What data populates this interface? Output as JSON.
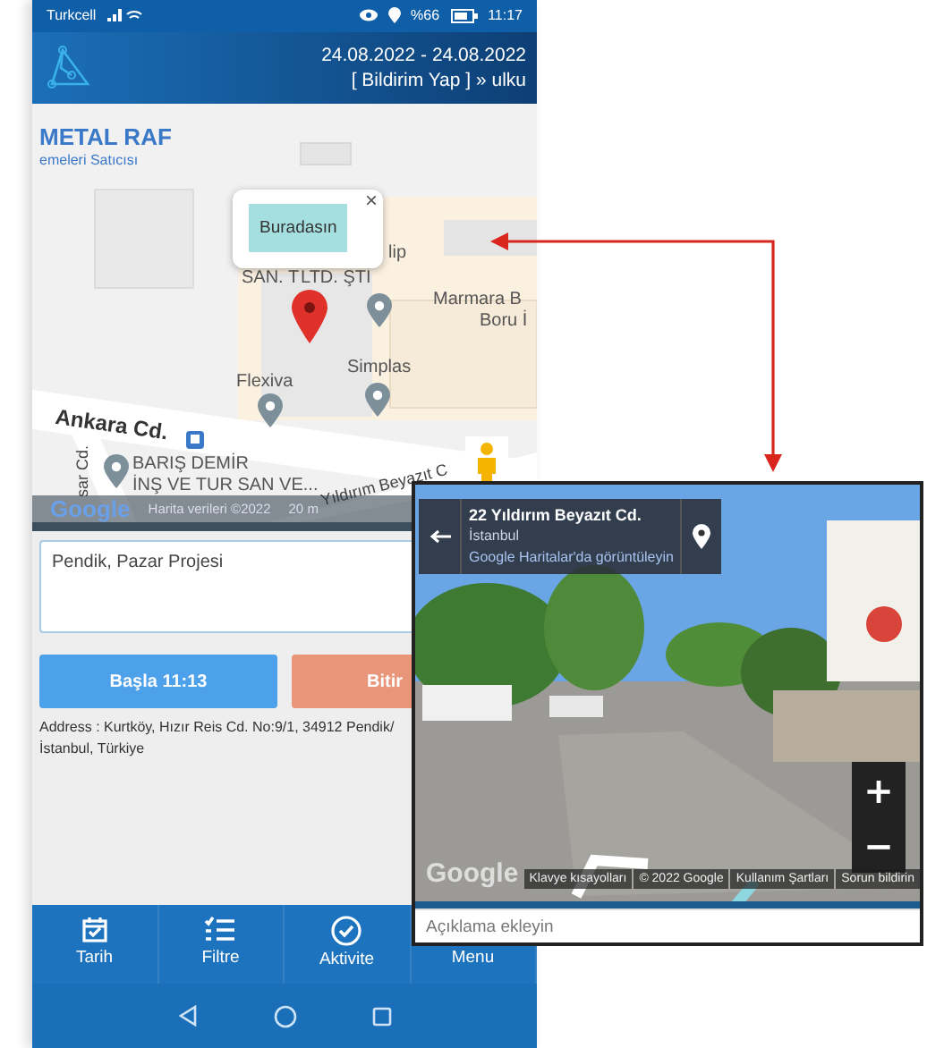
{
  "status_bar": {
    "carrier": "Turkcell",
    "battery": "%66",
    "time": "11:17"
  },
  "header": {
    "date_range": "24.08.2022 - 24.08.2022",
    "breadcrumb": "[ Bildirim Yap ] » ulku"
  },
  "map": {
    "labels": [
      {
        "text": "METAL RAF",
        "kind": "place"
      },
      {
        "text": "emeleri Satıcısı",
        "kind": "place_sub"
      },
      {
        "text": "lip",
        "kind": "poi"
      },
      {
        "text": "SAN. T",
        "kind": "poi"
      },
      {
        "text": "LTD. ŞTİ",
        "kind": "poi"
      },
      {
        "text": "Marmara B",
        "kind": "poi"
      },
      {
        "text": "Boru İ",
        "kind": "poi"
      },
      {
        "text": "Flexiva",
        "kind": "poi"
      },
      {
        "text": "Simplas",
        "kind": "poi"
      },
      {
        "text": "Ankara Cd.",
        "kind": "road"
      },
      {
        "text": "sar Cd.",
        "kind": "road_small"
      },
      {
        "text": "BARIŞ DEMİR",
        "kind": "poi"
      },
      {
        "text": "İNŞ VE TUR SAN VE...",
        "kind": "poi"
      },
      {
        "text": "Yıldırım Beyazıt C",
        "kind": "road_small"
      }
    ],
    "popup": {
      "text": "Buradasın",
      "close": "×"
    },
    "logo": "Google",
    "attribution": "Harita verileri ©2022",
    "scale": "20 m"
  },
  "note": {
    "value": "Pendik, Pazar Projesi"
  },
  "buttons": [
    {
      "label": "Başla 11:13",
      "kind": "start"
    },
    {
      "label": "Bitir",
      "kind": "end"
    }
  ],
  "address": "Address : Kurtköy, Hızır Reis Cd. No:9/1, 34912 Pendik/İstanbul, Türkiye",
  "bottom_nav": [
    {
      "label": "Tarih"
    },
    {
      "label": "Filtre"
    },
    {
      "label": "Aktivite"
    },
    {
      "label": "Menu"
    }
  ],
  "street_view": {
    "street": "22 Yıldırım Beyazıt Cd.",
    "city": "İstanbul",
    "link": "Google Haritalar'da görüntüleyin",
    "logo": "Google",
    "zoom_in": "+",
    "zoom_out": "−",
    "footer_links": [
      "Klavye kısayolları",
      "© 2022 Google",
      "Kullanım Şartları",
      "Sorun bildirin"
    ],
    "description": {
      "placeholder": "Açıklama ekleyin"
    }
  }
}
